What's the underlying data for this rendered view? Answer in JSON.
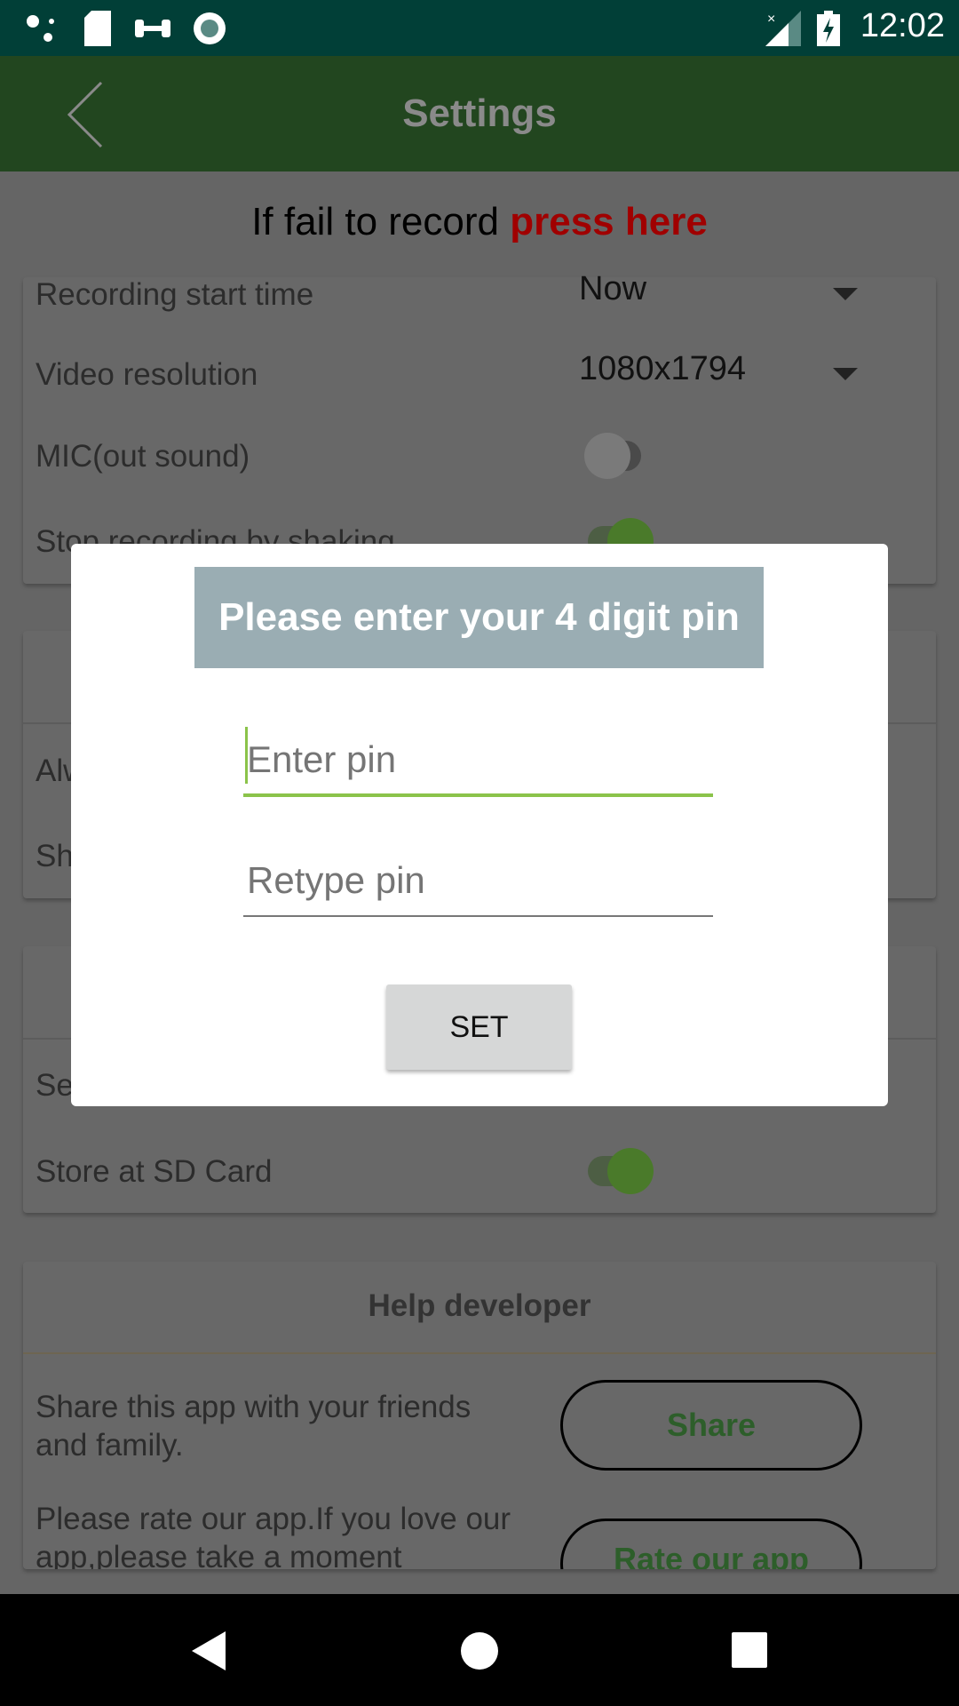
{
  "status_bar": {
    "time": "12:02",
    "icons": [
      "assistant-icon",
      "sd-card-icon",
      "dumbbell-icon",
      "record-icon",
      "no-signal-icon",
      "battery-charging-icon"
    ]
  },
  "app_bar": {
    "title": "Settings",
    "back_icon": "chevron-left-icon"
  },
  "banner": {
    "text": "If fail to record ",
    "link": "press here",
    "link_color": "#a00000"
  },
  "recording": {
    "rows": [
      {
        "label": "Recording start time",
        "value": "Now"
      },
      {
        "label": "Video resolution",
        "value": "1080x1794"
      },
      {
        "label": "MIC(out sound)",
        "toggle": false
      },
      {
        "label": "Stop recording by shaking",
        "toggle": true
      }
    ]
  },
  "card2": {
    "rows": [
      "Alw",
      "Sh"
    ]
  },
  "card3": {
    "rows": [
      {
        "label": "Se"
      },
      {
        "label": "Store at SD Card",
        "toggle": true
      }
    ]
  },
  "help": {
    "title": "Help developer",
    "share_text": "Share this app with your friends and family.",
    "share_button": "Share",
    "rate_text": "Please rate our app.If you love our app,please take a moment",
    "rate_button": "Rate our app"
  },
  "dialog": {
    "title": "Please enter your 4 digit pin",
    "pin_placeholder": "Enter pin",
    "retype_placeholder": "Retype pin",
    "set_button": "SET",
    "accent": "#8bc34a"
  },
  "colors": {
    "app_bar": "#22461f",
    "status_bar": "#013f37",
    "toggle_on": "#4a7a2a"
  }
}
